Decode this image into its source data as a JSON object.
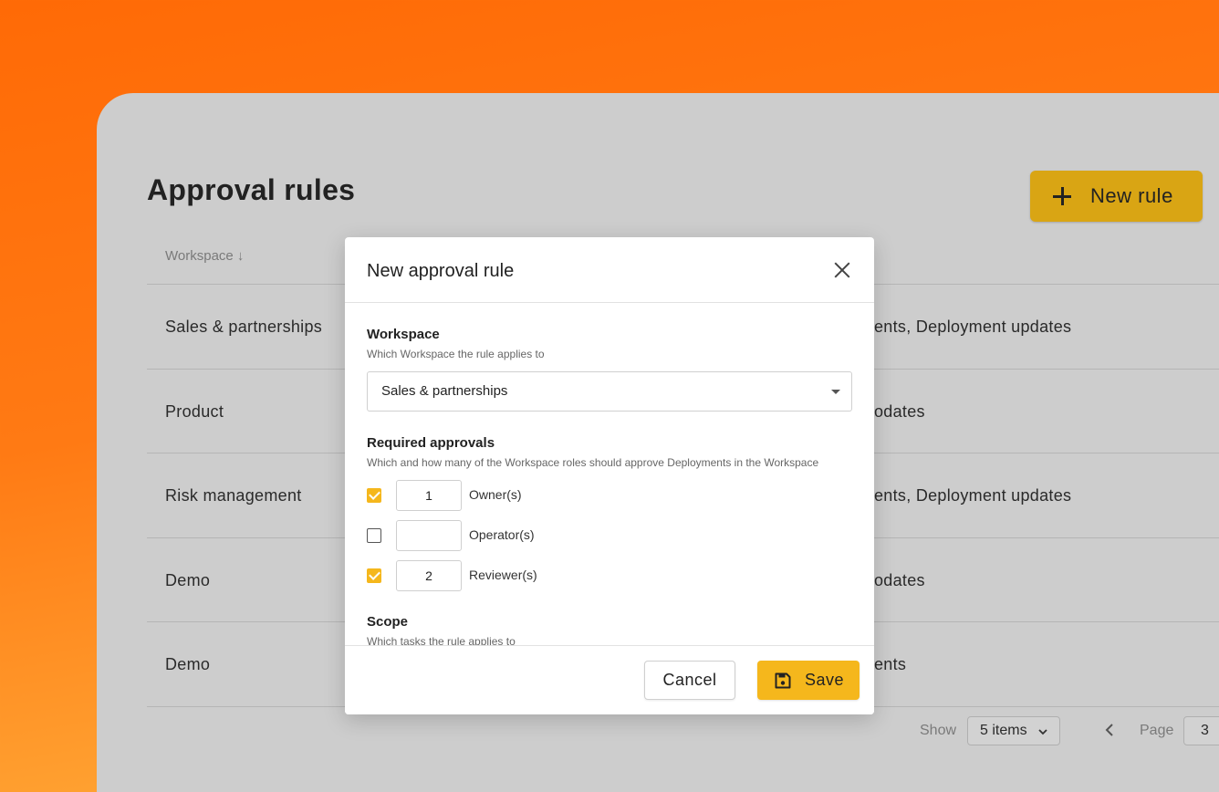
{
  "page": {
    "title": "Approval rules",
    "new_rule_label": "New rule",
    "column_workspace": "Workspace ↓"
  },
  "rows": [
    {
      "workspace": "Sales & partnerships",
      "notifications": "ents, Deployment updates"
    },
    {
      "workspace": "Product",
      "notifications": "odates"
    },
    {
      "workspace": "Risk management",
      "notifications": "ents, Deployment updates"
    },
    {
      "workspace": "Demo",
      "notifications": "odates"
    },
    {
      "workspace": "Demo",
      "notifications": "ents"
    }
  ],
  "pagination": {
    "show_label": "Show",
    "items_value": "5 items",
    "page_label": "Page",
    "page_value": "3"
  },
  "modal": {
    "title": "New approval rule",
    "workspace_section": {
      "title": "Workspace",
      "description": "Which Workspace the rule applies to",
      "selected": "Sales & partnerships"
    },
    "approvals_section": {
      "title": "Required approvals",
      "description": "Which and how many of the Workspace roles should approve Deployments in the Workspace",
      "roles": [
        {
          "label": "Owner(s)",
          "checked": true,
          "count": "1"
        },
        {
          "label": "Operator(s)",
          "checked": false,
          "count": ""
        },
        {
          "label": "Reviewer(s)",
          "checked": true,
          "count": "2"
        }
      ]
    },
    "scope_section": {
      "title": "Scope",
      "description": "Which tasks the rule applies to"
    },
    "cancel_label": "Cancel",
    "save_label": "Save"
  },
  "colors": {
    "accent": "#f5b71c",
    "background_orange": "#ff6a06",
    "panel": "#cdcdcd"
  },
  "icons": [
    "plus-icon",
    "sort-down-icon",
    "close-icon",
    "caret-down-icon",
    "checkmark-icon",
    "save-icon",
    "chevron-down-icon",
    "chevron-left-icon"
  ]
}
